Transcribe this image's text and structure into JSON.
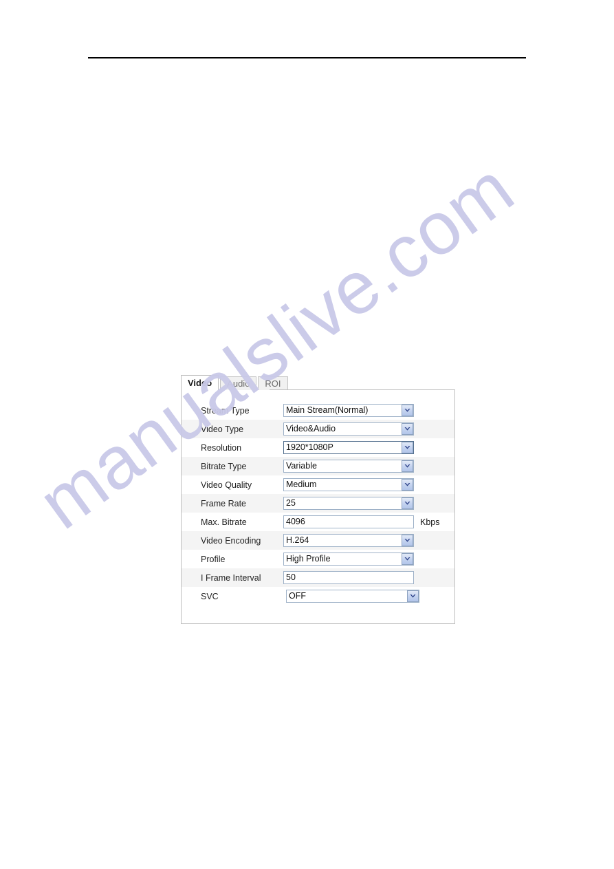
{
  "page": {
    "rule_visible": true,
    "watermark": "manualslive.com",
    "watermark_color": "#c9c9e8"
  },
  "panel": {
    "tabs": [
      {
        "label": "Video",
        "active": true
      },
      {
        "label": "Audio",
        "active": false
      },
      {
        "label": "ROI",
        "active": false
      }
    ],
    "rows": [
      {
        "label": "Stream Type",
        "value": "Main Stream(Normal)",
        "control": "select",
        "striped": false,
        "focused": false
      },
      {
        "label": "Video Type",
        "value": "Video&Audio",
        "control": "select",
        "striped": true,
        "focused": false
      },
      {
        "label": "Resolution",
        "value": "1920*1080P",
        "control": "select",
        "striped": false,
        "focused": true
      },
      {
        "label": "Bitrate Type",
        "value": "Variable",
        "control": "select",
        "striped": true,
        "focused": false
      },
      {
        "label": "Video Quality",
        "value": "Medium",
        "control": "select",
        "striped": false,
        "focused": false
      },
      {
        "label": "Frame Rate",
        "value": "25",
        "control": "select",
        "striped": true,
        "focused": false
      },
      {
        "label": "Max. Bitrate",
        "value": "4096",
        "control": "text",
        "striped": false,
        "focused": false,
        "unit": "Kbps"
      },
      {
        "label": "Video Encoding",
        "value": "H.264",
        "control": "select",
        "striped": true,
        "focused": false
      },
      {
        "label": "Profile",
        "value": "High Profile",
        "control": "select",
        "striped": false,
        "focused": false
      },
      {
        "label": "I Frame Interval",
        "value": "50",
        "control": "text",
        "striped": true,
        "focused": false
      },
      {
        "label": "SVC",
        "value": "OFF",
        "control": "select",
        "striped": false,
        "focused": false,
        "offset": true,
        "wide": true
      }
    ]
  }
}
